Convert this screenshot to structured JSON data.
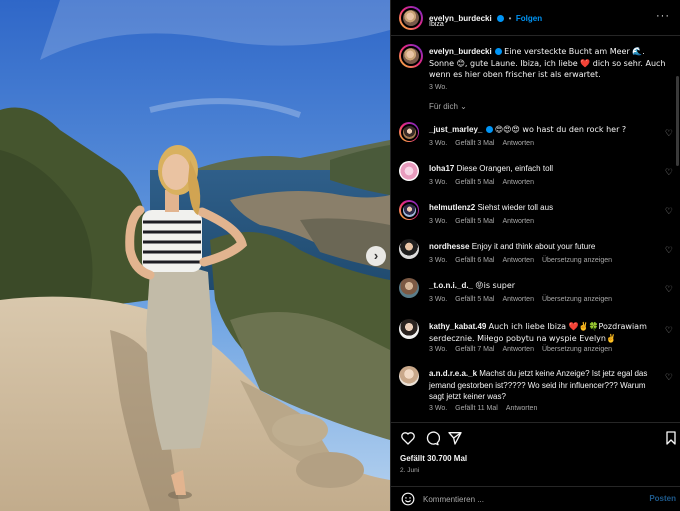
{
  "post": {
    "username": "evelyn_burdecki",
    "follow_label": "Folgen",
    "separator": "•",
    "location": "Ibiza",
    "more_label": "···"
  },
  "caption": {
    "username": "evelyn_burdecki",
    "text": "Eine versteckte Bucht am Meer 🌊. Sonne 😊, gute Laune. Ibiza, ich liebe ❤️ dich so sehr. Auch wenn es hier oben frischer ist als erwartet.",
    "time": "3 Wo."
  },
  "sort_label": "Für dich ⌄",
  "comments": [
    {
      "username": "_just_marley_",
      "verified": true,
      "text": "😍😍😍 wo hast du den rock her ?",
      "time": "3 Wo.",
      "likes": "Gefällt 3 Mal",
      "reply": "Antworten",
      "translate": ""
    },
    {
      "username": "loha17",
      "verified": false,
      "text": "Diese Orangen, einfach toll",
      "time": "3 Wo.",
      "likes": "Gefällt 5 Mal",
      "reply": "Antworten",
      "translate": ""
    },
    {
      "username": "helmutlenz2",
      "verified": false,
      "text": "Siehst wieder toll aus",
      "time": "3 Wo.",
      "likes": "Gefällt 5 Mal",
      "reply": "Antworten",
      "translate": ""
    },
    {
      "username": "nordhesse",
      "verified": false,
      "text": "Enjoy it and think about your future",
      "time": "3 Wo.",
      "likes": "Gefällt 6 Mal",
      "reply": "Antworten",
      "translate": "Übersetzung anzeigen"
    },
    {
      "username": "_t.o.n.i._d._",
      "verified": false,
      "text": "😝is super",
      "time": "3 Wo.",
      "likes": "Gefällt 5 Mal",
      "reply": "Antworten",
      "translate": "Übersetzung anzeigen"
    },
    {
      "username": "kathy_kabat.49",
      "verified": false,
      "text": "Auch ich liebe Ibiza ❤️✌️🍀Pozdrawiam serdecznie. Miłego pobytu na wyspie Evelyn✌️",
      "time": "3 Wo.",
      "likes": "Gefällt 7 Mal",
      "reply": "Antworten",
      "translate": "Übersetzung anzeigen"
    },
    {
      "username": "a.n.d.r.e.a._k",
      "verified": false,
      "text": "Machst du jetzt keine Anzeige? Ist jetz egal das jemand gestorben ist????? Wo seid ihr influencer??? Warum sagt jetzt keiner was?",
      "time": "3 Wo.",
      "likes": "Gefällt 11 Mal",
      "reply": "Antworten",
      "translate": ""
    }
  ],
  "actions": {
    "likes": "Gefällt 30.700 Mal",
    "date": "2. Juni",
    "comment_placeholder": "Kommentieren ...",
    "post_label": "Posten"
  },
  "icons": [
    "more-icon",
    "heart-icon",
    "comment-icon",
    "share-icon",
    "bookmark-icon",
    "emoji-icon",
    "chevron-right-icon",
    "verified-icon"
  ],
  "colors": {
    "link": "#0095f6",
    "muted": "#a8a8a8",
    "background": "#000000",
    "post_disabled": "#1e5a8c"
  }
}
